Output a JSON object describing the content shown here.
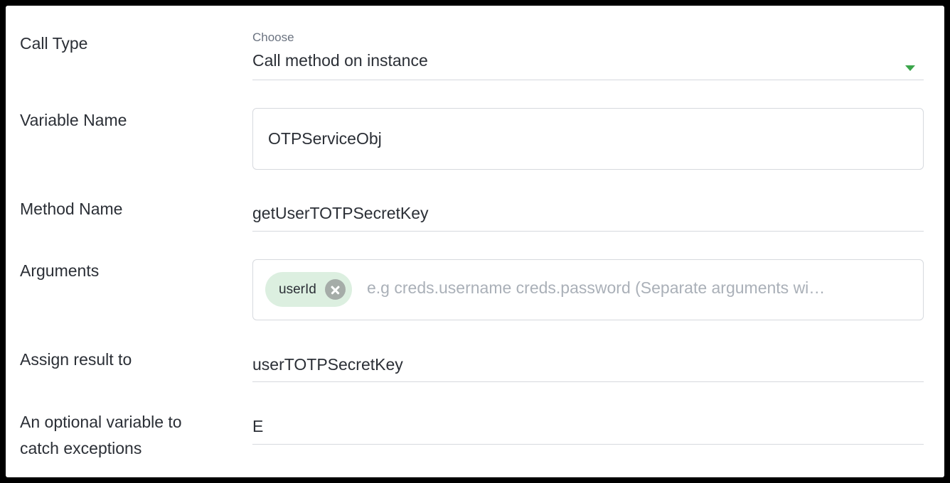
{
  "call_type": {
    "label": "Call Type",
    "choose_label": "Choose",
    "value": "Call method on instance",
    "caret_color": "#3aa54a"
  },
  "variable_name": {
    "label": "Variable Name",
    "value": "OTPServiceObj"
  },
  "method_name": {
    "label": "Method Name",
    "value": "getUserTOTPSecretKey"
  },
  "arguments": {
    "label": "Arguments",
    "chips": [
      "userId"
    ],
    "placeholder": "e.g creds.username creds.password (Separate arguments wi…"
  },
  "assign_result": {
    "label": "Assign result to",
    "value": "userTOTPSecretKey"
  },
  "exception_var": {
    "label_line1": "An optional variable to",
    "label_line2": "catch exceptions",
    "value": "E"
  },
  "colors": {
    "chip_background": "#dcefe0",
    "border": "#d6d9de"
  }
}
